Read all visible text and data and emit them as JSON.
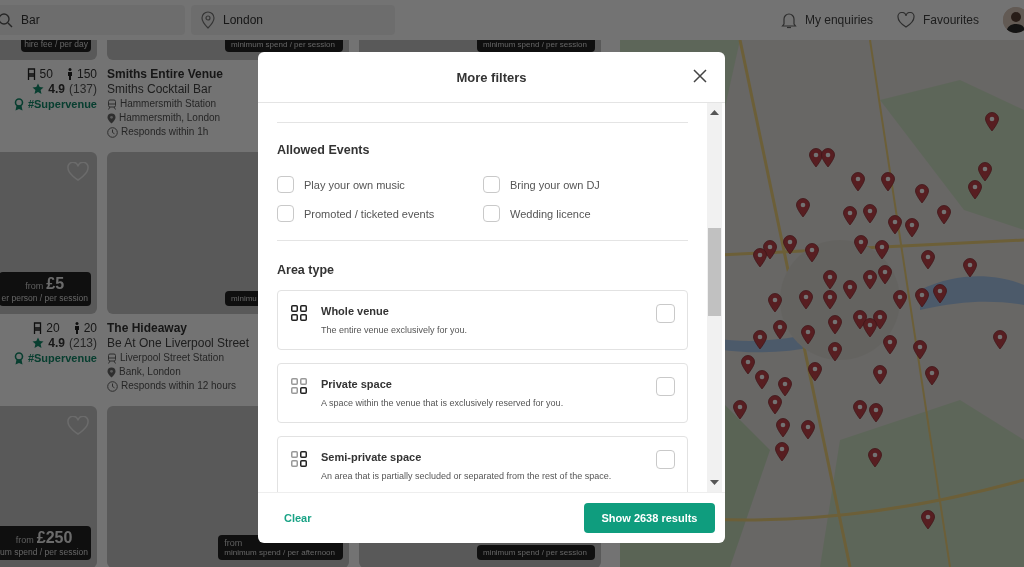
{
  "search_bar": {
    "query": "Bar",
    "location": "London"
  },
  "header_links": [
    {
      "kind": "bell",
      "label": "My enquiries"
    },
    {
      "kind": "heart",
      "label": "Favourites"
    }
  ],
  "venue_rows": [
    {
      "cards": [
        {
          "badge_note": "hire fee / per day",
          "seated": "50",
          "standing": "150",
          "rating": "4.9",
          "reviews": "(137)",
          "tag": "#Supervenue"
        },
        {
          "badge_note": "minimum spend / per session",
          "title": "Smiths Entire Venue",
          "subtitle": "Smiths Cocktail Bar",
          "station": "Hammersmith Station",
          "area": "Hammersmith, London",
          "response": "Responds within 1h"
        },
        {
          "badge_note": "minimum spend / per session"
        }
      ]
    },
    {
      "cards": [
        {
          "favourite": false,
          "badge_from": "from",
          "badge_price": "£5",
          "badge_note": "er person / per session",
          "seated": "20",
          "standing": "20",
          "rating": "4.9",
          "reviews": "(213)",
          "tag": "#Supervenue"
        },
        {
          "badge_note": "minimu",
          "title": "The Hideaway",
          "subtitle": "Be At One Liverpool Street",
          "station": "Liverpool Street Station",
          "area": "Bank, London",
          "response": "Responds within 12 hours"
        }
      ]
    },
    {
      "cards": [
        {
          "favourite": false,
          "badge_from": "from",
          "badge_price": "£250",
          "badge_note": "um spend / per session"
        },
        {
          "badge_from": "from",
          "badge_note": "minimum spend / per afternoon"
        },
        {
          "badge_note": "minimum spend / per session"
        }
      ]
    }
  ],
  "filters_modal": {
    "title": "More filters",
    "sections": [
      {
        "kind": "checklist",
        "title": "Allowed Events",
        "options": [
          {
            "label": "Play your own music",
            "checked": false
          },
          {
            "label": "Bring your own DJ",
            "checked": false
          },
          {
            "label": "Promoted / ticketed events",
            "checked": false
          },
          {
            "label": "Wedding licence",
            "checked": false
          }
        ]
      },
      {
        "kind": "cards",
        "title": "Area type",
        "options": [
          {
            "kind": "whole",
            "label": "Whole venue",
            "description": "The entire venue exclusively for you.",
            "checked": false
          },
          {
            "kind": "private",
            "label": "Private space",
            "description": "A space within the venue that is exclusively reserved for you.",
            "checked": false
          },
          {
            "kind": "semi",
            "label": "Semi-private space",
            "description": "An area that is partially secluded or separated from the rest of the space.",
            "checked": false
          }
        ]
      }
    ],
    "clear": "Clear",
    "submit": "Show 2638 results"
  }
}
